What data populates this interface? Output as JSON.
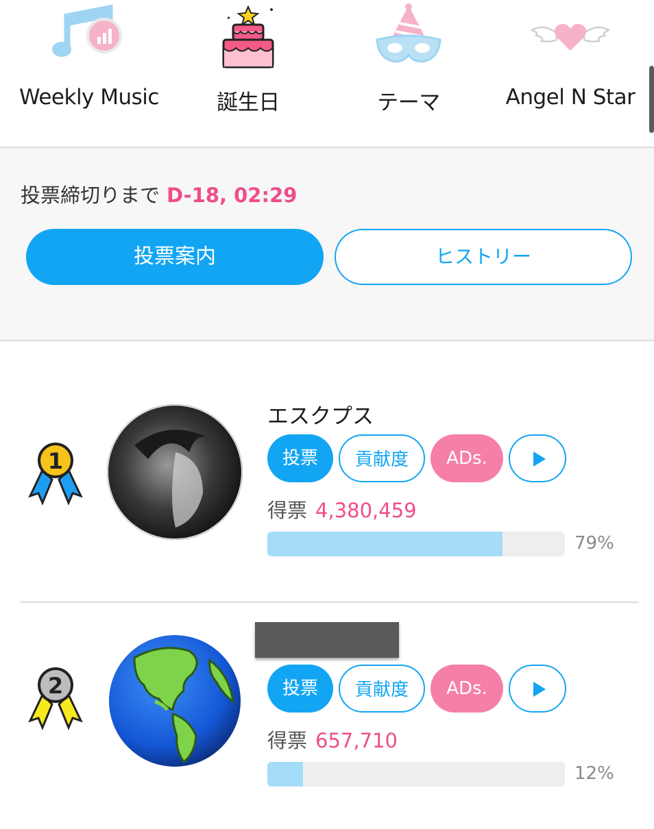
{
  "categories": [
    {
      "label": "Weekly Music",
      "icon": "music-note-chart-icon"
    },
    {
      "label": "誕生日",
      "icon": "birthday-cake-icon"
    },
    {
      "label": "テーマ",
      "icon": "party-mask-icon"
    },
    {
      "label": "Angel N Star",
      "icon": "winged-heart-icon"
    }
  ],
  "deadline": {
    "label": "投票締切りまで",
    "value": "D-18, 02:29"
  },
  "buttons": {
    "guide": "投票案内",
    "history": "ヒストリー"
  },
  "entries": [
    {
      "rank": "1",
      "name": "エスクプス",
      "vote_label": "投票",
      "contrib_label": "貢献度",
      "ads_label": "ADs.",
      "votes_label": "得票",
      "votes": "4,380,459",
      "share": 0.79,
      "percent_text": "79%"
    },
    {
      "rank": "2",
      "name": "",
      "vote_label": "投票",
      "contrib_label": "貢献度",
      "ads_label": "ADs.",
      "votes_label": "得票",
      "votes": "657,710",
      "share": 0.12,
      "percent_text": "12%"
    }
  ],
  "colors": {
    "accent_blue": "#12a5f3",
    "accent_pink": "#ef4d8b",
    "bar_fill": "#a5dcf8"
  }
}
